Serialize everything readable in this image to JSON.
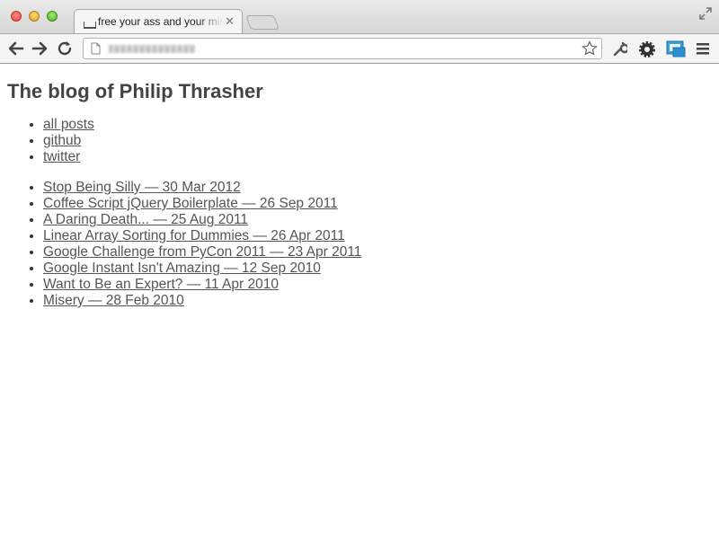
{
  "browser": {
    "tab": {
      "title": "free your ass and your mind"
    },
    "address_bar": {
      "url": ""
    }
  },
  "page": {
    "title": "The blog of Philip Thrasher",
    "nav_links": [
      {
        "label": "all posts"
      },
      {
        "label": "github"
      },
      {
        "label": "twitter"
      }
    ],
    "posts": [
      {
        "label": "Stop Being Silly — 30 Mar 2012"
      },
      {
        "label": "Coffee Script jQuery Boilerplate — 26 Sep 2011"
      },
      {
        "label": "A Daring Death... — 25 Aug 2011"
      },
      {
        "label": "Linear Array Sorting for Dummies — 26 Apr 2011"
      },
      {
        "label": "Google Challenge from PyCon 2011 — 23 Apr 2011"
      },
      {
        "label": "Google Instant Isn't Amazing — 12 Sep 2010"
      },
      {
        "label": "Want to Be an Expert? — 11 Apr 2010"
      },
      {
        "label": "Misery — 28 Feb 2010"
      }
    ]
  },
  "icons": {
    "traffic_close": "close-window-icon",
    "traffic_minimize": "minimize-window-icon",
    "traffic_zoom": "zoom-window-icon",
    "back": "back-arrow-icon",
    "forward": "forward-arrow-icon",
    "reload": "reload-icon",
    "bookmark": "star-icon",
    "wrench": "wrench-icon",
    "extension": "gear-icon",
    "cast": "screen-share-icon",
    "menu": "menu-icon"
  },
  "colors": {
    "text": "#444444",
    "link": "#555555"
  }
}
